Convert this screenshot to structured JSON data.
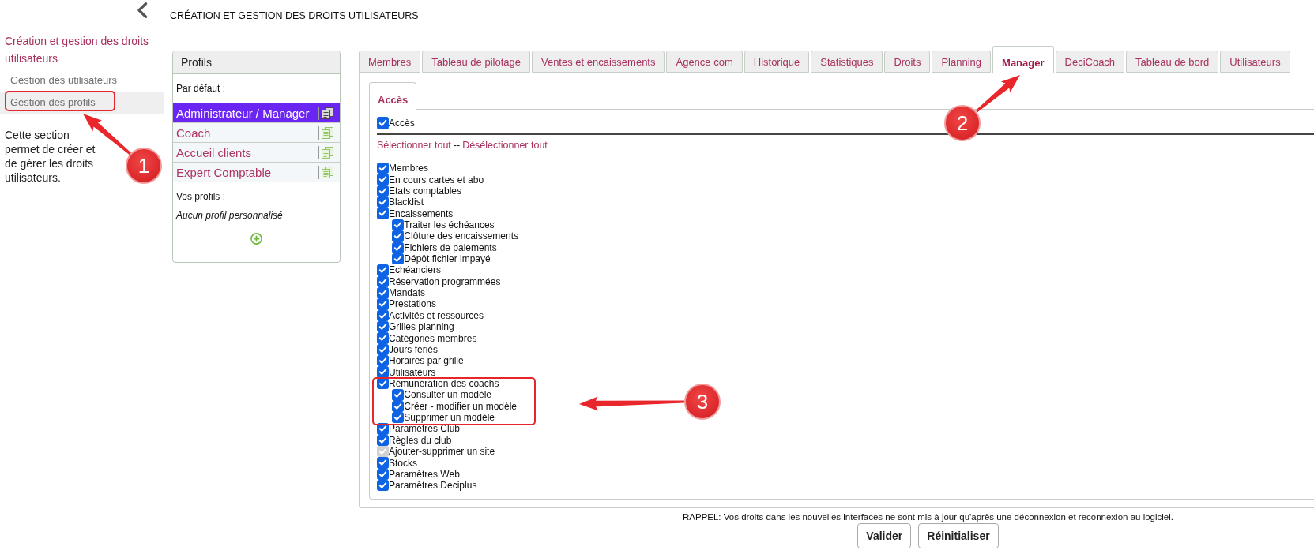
{
  "sidebar": {
    "title": "Création et gestion des droits utilisateurs",
    "items": [
      {
        "label": "Gestion des utilisateurs",
        "selected": false
      },
      {
        "label": "Gestion des profils",
        "selected": true
      }
    ],
    "description": "Cette section permet de créer et de gérer les droits utilisateurs."
  },
  "page_title": "CRÉATION ET GESTION DES DROITS UTILISATEURS",
  "profiles": {
    "title": "Profils",
    "default_heading": "Par défaut :",
    "defaults": [
      {
        "label": "Administrateur / Manager",
        "selected": true
      },
      {
        "label": "Coach",
        "selected": false
      },
      {
        "label": "Accueil clients",
        "selected": false
      },
      {
        "label": "Expert Comptable",
        "selected": false
      }
    ],
    "custom_heading": "Vos profils :",
    "custom_empty": "Aucun profil personnalisé"
  },
  "tabs": [
    {
      "label": "Membres",
      "selected": false
    },
    {
      "label": "Tableau de pilotage",
      "selected": false
    },
    {
      "label": "Ventes et encaissements",
      "selected": false
    },
    {
      "label": "Agence com",
      "selected": false
    },
    {
      "label": "Historique",
      "selected": false
    },
    {
      "label": "Statistiques",
      "selected": false
    },
    {
      "label": "Droits",
      "selected": false
    },
    {
      "label": "Planning",
      "selected": false
    },
    {
      "label": "Manager",
      "selected": true
    },
    {
      "label": "DeciCoach",
      "selected": false
    },
    {
      "label": "Tableau de bord",
      "selected": false
    },
    {
      "label": "Utilisateurs",
      "selected": false
    }
  ],
  "access": {
    "tabs": [
      {
        "label": "Accès",
        "selected": true
      }
    ],
    "master": {
      "label": "Accès",
      "checked": true
    },
    "select_all": "Sélectionner tout",
    "separator": "--",
    "deselect_all": "Désélectionner tout",
    "permissions": [
      {
        "label": "Membres",
        "checked": true,
        "disabled": false
      },
      {
        "label": "En cours cartes et abo",
        "checked": true,
        "disabled": false
      },
      {
        "label": "Etats comptables",
        "checked": true,
        "disabled": false
      },
      {
        "label": "Blacklist",
        "checked": true,
        "disabled": false
      },
      {
        "label": "Encaissements",
        "checked": true,
        "disabled": false,
        "children": [
          {
            "label": "Traiter les échéances",
            "checked": true,
            "disabled": false
          },
          {
            "label": "Clôture des encaissements",
            "checked": true,
            "disabled": false
          },
          {
            "label": "Fichiers de paiements",
            "checked": true,
            "disabled": false
          },
          {
            "label": "Dépôt fichier impayé",
            "checked": true,
            "disabled": false
          }
        ]
      },
      {
        "label": "Echéanciers",
        "checked": true,
        "disabled": false
      },
      {
        "label": "Réservation programmées",
        "checked": true,
        "disabled": false
      },
      {
        "label": "Mandats",
        "checked": true,
        "disabled": false
      },
      {
        "label": "Prestations",
        "checked": true,
        "disabled": false
      },
      {
        "label": "Activités et ressources",
        "checked": true,
        "disabled": false
      },
      {
        "label": "Grilles planning",
        "checked": true,
        "disabled": false
      },
      {
        "label": "Catégories membres",
        "checked": true,
        "disabled": false
      },
      {
        "label": "Jours fériés",
        "checked": true,
        "disabled": false
      },
      {
        "label": "Horaires par grille",
        "checked": true,
        "disabled": false
      },
      {
        "label": "Utilisateurs",
        "checked": true,
        "disabled": false
      },
      {
        "label": "Rémunération des coachs",
        "checked": true,
        "disabled": false,
        "children": [
          {
            "label": "Consulter un modèle",
            "checked": true,
            "disabled": false
          },
          {
            "label": "Créer - modifier un modèle",
            "checked": true,
            "disabled": false
          },
          {
            "label": "Supprimer un modèle",
            "checked": true,
            "disabled": false
          }
        ]
      },
      {
        "label": "Paramètres Club",
        "checked": true,
        "disabled": false
      },
      {
        "label": "Règles du club",
        "checked": true,
        "disabled": false
      },
      {
        "label": "Ajouter-supprimer un site",
        "checked": true,
        "disabled": true
      },
      {
        "label": "Stocks",
        "checked": true,
        "disabled": false
      },
      {
        "label": "Paramètres Web",
        "checked": true,
        "disabled": false
      },
      {
        "label": "Paramètres Deciplus",
        "checked": true,
        "disabled": false
      }
    ]
  },
  "notice": "RAPPEL: Vos droits dans les nouvelles interfaces ne sont mis à jour qu'après une déconnexion et reconnexion au logiciel.",
  "buttons": [
    "Valider",
    "Réinitialiser"
  ],
  "annotations": [
    {
      "number": "1"
    },
    {
      "number": "2"
    },
    {
      "number": "3"
    }
  ]
}
